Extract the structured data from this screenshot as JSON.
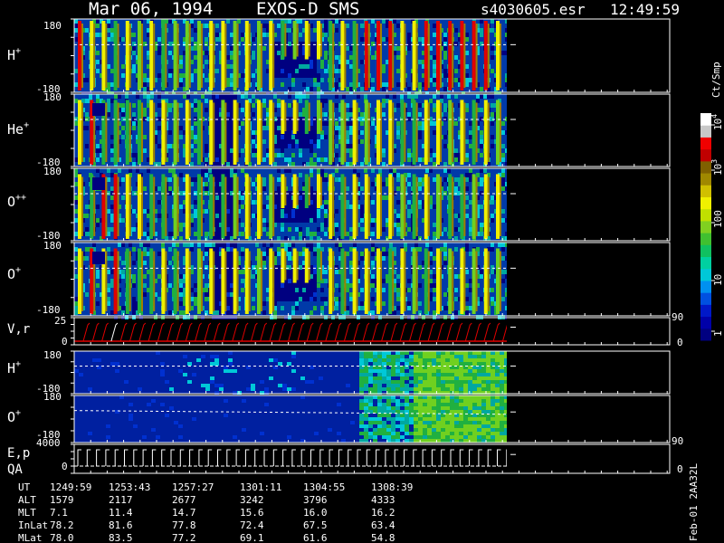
{
  "header": {
    "date": "Mar 06, 1994",
    "instrument": "EXOS-D SMS",
    "file": "s4030605.esr",
    "time": "12:49:59"
  },
  "colorbar": {
    "unit": "Ct/Smp",
    "ticks": [
      "1",
      "10",
      "100",
      "10",
      "10"
    ],
    "tick_exponents": [
      "",
      "",
      "",
      "3",
      "4"
    ],
    "tick_values": [
      1,
      10,
      100,
      1000,
      10000
    ],
    "colors": [
      "#000080",
      "#0000a8",
      "#0018c8",
      "#0050e0",
      "#0090f0",
      "#00c8d8",
      "#00d0a0",
      "#10c060",
      "#40c030",
      "#80d020",
      "#c0e000",
      "#f0f000",
      "#d0c000",
      "#a08800",
      "#806000",
      "#c00000",
      "#f00000",
      "#c8c8c8",
      "#ffffff"
    ]
  },
  "spectrograms": [
    {
      "species": "H",
      "charge": "+",
      "ymax": "180",
      "ymin": "-180"
    },
    {
      "species": "He",
      "charge": "+",
      "ymax": "180",
      "ymin": "-180"
    },
    {
      "species": "O",
      "charge": "++",
      "ymax": "180",
      "ymin": "-180"
    },
    {
      "species": "O",
      "charge": "+",
      "ymax": "180",
      "ymin": "-180"
    }
  ],
  "vr_panel": {
    "label": "V,r",
    "ymax": "25",
    "ymin": "0",
    "right_top": "90",
    "right_bottom": "0"
  },
  "pitch_panels": [
    {
      "species": "H",
      "charge": "+",
      "ymax": "180",
      "ymin": "-180"
    },
    {
      "species": "O",
      "charge": "+",
      "ymax": "180",
      "ymin": "-180",
      "right_bottom": "90"
    }
  ],
  "ep_panel": {
    "label1": "E,p",
    "label2": "QA",
    "ymax": "4000",
    "ymin": "0",
    "right_bottom": "0"
  },
  "ephemeris": {
    "labels": [
      "UT",
      "ALT",
      "MLT",
      "InLat",
      "MLat"
    ],
    "columns": [
      {
        "UT": "1249:59",
        "ALT": "1579",
        "MLT": "7.1",
        "InLat": "78.2",
        "MLat": "78.0"
      },
      {
        "UT": "1253:43",
        "ALT": "2117",
        "MLT": "11.4",
        "InLat": "81.6",
        "MLat": "83.5"
      },
      {
        "UT": "1257:27",
        "ALT": "2677",
        "MLT": "14.7",
        "InLat": "77.8",
        "MLat": "77.2"
      },
      {
        "UT": "1301:11",
        "ALT": "3242",
        "MLT": "15.6",
        "InLat": "72.4",
        "MLat": "69.1"
      },
      {
        "UT": "1304:55",
        "ALT": "3796",
        "MLT": "16.0",
        "InLat": "67.5",
        "MLat": "61.6"
      },
      {
        "UT": "1308:39",
        "ALT": "4333",
        "MLT": "16.2",
        "InLat": "63.4",
        "MLat": "54.8"
      }
    ]
  },
  "footer_stamp": "Feb-01 2AA32L",
  "chart_data": {
    "type": "heatmap",
    "title": "Mar 06, 1994   EXOS-D SMS",
    "x": [
      "1249:59",
      "1253:43",
      "1257:27",
      "1301:11",
      "1304:55",
      "1308:39"
    ],
    "panels": [
      "H+",
      "He+",
      "O++",
      "O+",
      "V,r",
      "H+",
      "O+",
      "E,p QA"
    ],
    "zlabel": "Ct/Smp",
    "zlim": [
      1,
      10000
    ],
    "zscale": "log",
    "ylim_angle": [
      -180,
      180
    ],
    "ylim_vr": [
      0,
      25
    ],
    "ylim_energy": [
      0,
      4000
    ]
  }
}
